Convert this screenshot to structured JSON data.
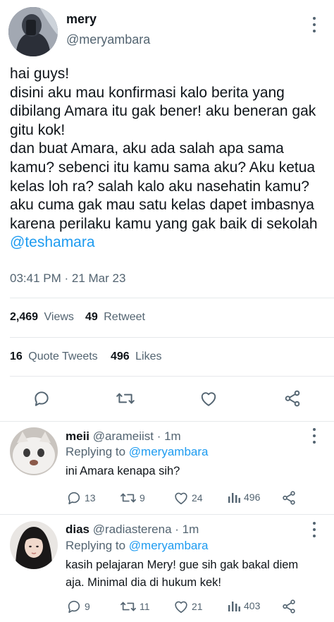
{
  "main_tweet": {
    "name": "mery",
    "handle": "@meryambara",
    "text": "hai guys!\ndisini aku mau konfirmasi kalo berita yang dibilang Amara itu gak bener! aku beneran gak gitu kok!\ndan buat Amara, aku ada salah apa sama kamu? sebenci itu kamu sama aku? Aku ketua kelas loh ra? salah kalo aku nasehatin kamu? aku cuma gak mau satu kelas dapet imbasnya karena perilaku kamu yang gak baik di sekolah ",
    "mention": "@teshamara",
    "timestamp": "03:41 PM · 21 Mar 23",
    "views_count": "2,469",
    "views_label": "Views",
    "retweet_count": "49",
    "retweet_label": "Retweet",
    "quote_count": "16",
    "quote_label": "Quote Tweets",
    "likes_count": "496",
    "likes_label": "Likes"
  },
  "replies": [
    {
      "name": "meii",
      "handle_time": "@aramеiist · 1m",
      "replying_label": "Replying to",
      "replying_to": "@meryambara",
      "text": "ini Amara kenapa sih?",
      "reply_count": "13",
      "retweet_count": "9",
      "like_count": "24",
      "view_count": "496"
    },
    {
      "name": "dias",
      "handle_time": "@radiasterena · 1m",
      "replying_label": "Replying to",
      "replying_to": "@meryambara",
      "text": "kasih pelajaran Mery! gue sih gak bakal diem aja. Minimal dia di hukum kek!",
      "reply_count": "9",
      "retweet_count": "11",
      "like_count": "21",
      "view_count": "403"
    }
  ],
  "icons": {
    "reply": "reply-icon",
    "retweet": "retweet-icon",
    "like": "heart-icon",
    "share": "share-icon",
    "views": "views-icon",
    "more": "more-icon"
  },
  "colors": {
    "accent": "#1d9bf0",
    "text": "#0f1419",
    "muted": "#536471",
    "divider": "#e6e9eb"
  }
}
